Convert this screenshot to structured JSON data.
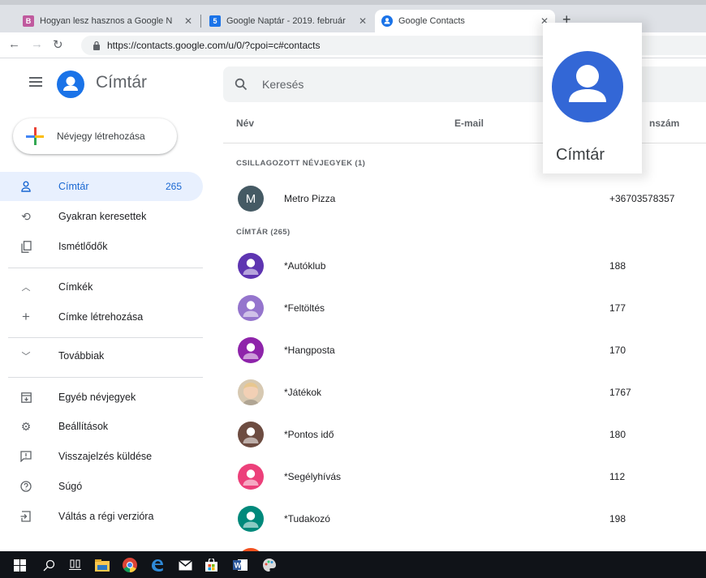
{
  "browser": {
    "tabs": [
      {
        "title": "Hogyan lesz hasznos a Google N",
        "favicon": "B",
        "favicon_color": "#c05a9e"
      },
      {
        "title": "Google Naptár - 2019. február",
        "favicon": "5",
        "favicon_color": "#1a73e8"
      },
      {
        "title": "Google Contacts",
        "favicon": "contacts-icon",
        "favicon_color": "#1a73e8"
      }
    ],
    "url": "https://contacts.google.com/u/0/?cpoi=c#contacts"
  },
  "app": {
    "title": "Címtár",
    "search_placeholder": "Keresés",
    "accent": "#1a73e8"
  },
  "sidebar": {
    "create_label": "Névjegy létrehozása",
    "items": [
      {
        "label": "Címtár",
        "count": "265",
        "icon": "person-icon",
        "active": true
      },
      {
        "label": "Gyakran keresettek",
        "icon": "history-icon"
      },
      {
        "label": "Ismétlődők",
        "icon": "copy-icon"
      },
      {
        "label": "Címkék",
        "icon": "chevron-up-icon"
      },
      {
        "label": "Címke létrehozása",
        "icon": "plus-icon"
      },
      {
        "label": "Továbbiak",
        "icon": "chevron-down-icon"
      },
      {
        "label": "Egyéb névjegyek",
        "icon": "archive-icon"
      },
      {
        "label": "Beállítások",
        "icon": "gear-icon"
      },
      {
        "label": "Visszajelzés küldése",
        "icon": "feedback-icon"
      },
      {
        "label": "Súgó",
        "icon": "help-icon"
      },
      {
        "label": "Váltás a régi verzióra",
        "icon": "exit-icon"
      }
    ]
  },
  "list": {
    "columns": {
      "name": "Név",
      "email": "E-mail",
      "phone": "nszám"
    },
    "starred_header": "CSILLAGOZOTT NÉVJEGYEK (1)",
    "all_header": "CÍMTÁR (265)",
    "starred": [
      {
        "name": "Metro Pizza",
        "phone": "+36703578357",
        "initial": "M",
        "color": "#455a64"
      }
    ],
    "contacts": [
      {
        "name": "*Autóklub",
        "phone": "188",
        "color": "#5e35b1"
      },
      {
        "name": "*Feltöltés",
        "phone": "177",
        "color": "#9575cd"
      },
      {
        "name": "*Hangposta",
        "phone": "170",
        "color": "#8e24aa"
      },
      {
        "name": "*Játékok",
        "phone": "1767",
        "color": "photo"
      },
      {
        "name": "*Pontos idő",
        "phone": "180",
        "color": "#6d4c41"
      },
      {
        "name": "*Segélyhívás",
        "phone": "112",
        "color": "#ec407a"
      },
      {
        "name": "*Tudakozó",
        "phone": "198",
        "color": "#00897b"
      }
    ]
  },
  "zoom": {
    "title": "Címtár"
  }
}
